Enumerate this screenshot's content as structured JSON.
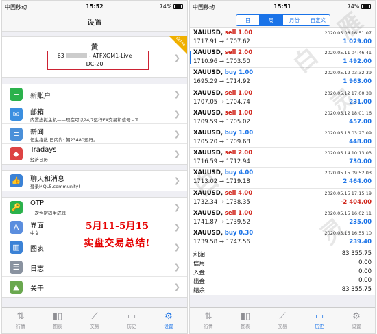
{
  "left": {
    "status": {
      "carrier": "中国移动",
      "time": "15:52",
      "battery": "74%"
    },
    "title": "设置",
    "account": {
      "name": "黄",
      "number": "63",
      "server_suffix": "- ATFXGM1-Live",
      "server_line2": "DC-20",
      "badge": "demo"
    },
    "group1": [
      {
        "icon": "user-plus-icon",
        "color": "#2bb24c",
        "glyph": "+",
        "title": "新账户",
        "sub": ""
      },
      {
        "icon": "mail-icon",
        "color": "#3b8fe0",
        "glyph": "✉",
        "title": "邮箱",
        "sub": "内置虚拟主机——现在可以24/7运行EA交易和信号 - Tr..."
      },
      {
        "icon": "news-icon",
        "color": "#4a90d9",
        "glyph": "≡",
        "title": "新闻",
        "sub": "恒生指数 日内尚: 朝23480运行。"
      },
      {
        "icon": "tradays-icon",
        "color": "#d44",
        "glyph": "◆",
        "title": "Tradays",
        "sub": "经济日历"
      }
    ],
    "group2": [
      {
        "icon": "chat-icon",
        "color": "#3b82d6",
        "glyph": "👍",
        "title": "聊天和消息",
        "sub": "登录MQL5.community!"
      }
    ],
    "group3": [
      {
        "icon": "otp-icon",
        "color": "#2bb24c",
        "glyph": "🔑",
        "title": "OTP",
        "sub": "一次性密码生成器"
      },
      {
        "icon": "language-icon",
        "color": "#5b8ede",
        "glyph": "A",
        "title": "界面",
        "sub": "中文"
      },
      {
        "icon": "chart-settings-icon",
        "color": "#3b82d6",
        "glyph": "▥",
        "title": "图表",
        "sub": ""
      },
      {
        "icon": "journal-icon",
        "color": "#8a93a0",
        "glyph": "☰",
        "title": "日志",
        "sub": ""
      },
      {
        "icon": "about-icon",
        "color": "#6aa84f",
        "glyph": "▲",
        "title": "关于",
        "sub": ""
      }
    ],
    "overlay": {
      "line1": "5月11-5月15",
      "line2": "实盘交易总结!"
    },
    "tabs": [
      {
        "icon": "quotes-icon",
        "glyph": "⇅",
        "label": "行情"
      },
      {
        "icon": "chart-icon",
        "glyph": "▮▯",
        "label": "图表"
      },
      {
        "icon": "trade-icon",
        "glyph": "⟋",
        "label": "交易"
      },
      {
        "icon": "history-icon",
        "glyph": "▭",
        "label": "历史"
      },
      {
        "icon": "settings-icon",
        "glyph": "⚙",
        "label": "设置",
        "active": true
      }
    ]
  },
  "right": {
    "status": {
      "carrier": "中国移动",
      "time": "15:51",
      "battery": "74%"
    },
    "segments": [
      {
        "label": "日"
      },
      {
        "label": "周",
        "active": true
      },
      {
        "label": "月份"
      },
      {
        "label": "自定义"
      }
    ],
    "deals": [
      {
        "symbol": "XAUUSD,",
        "side": "sell",
        "lots": "1.00",
        "date": "2020.05.08 16:51:07",
        "prices": "1717.91 → 1707.62",
        "profit": "1 029.00",
        "sign": "pos"
      },
      {
        "symbol": "XAUUSD,",
        "side": "sell",
        "lots": "2.00",
        "date": "2020.05.11 04:46:41",
        "prices": "1710.96 → 1703.50",
        "profit": "1 492.00",
        "sign": "pos"
      },
      {
        "symbol": "XAUUSD,",
        "side": "buy",
        "lots": "1.00",
        "date": "2020.05.12 03:32:39",
        "prices": "1695.29 → 1714.92",
        "profit": "1 963.00",
        "sign": "pos"
      },
      {
        "symbol": "XAUUSD,",
        "side": "sell",
        "lots": "1.00",
        "date": "2020.05.12 17:00:38",
        "prices": "1707.05 → 1704.74",
        "profit": "231.00",
        "sign": "pos"
      },
      {
        "symbol": "XAUUSD,",
        "side": "sell",
        "lots": "1.00",
        "date": "2020.05.12 18:01:16",
        "prices": "1709.59 → 1705.02",
        "profit": "457.00",
        "sign": "pos"
      },
      {
        "symbol": "XAUUSD,",
        "side": "buy",
        "lots": "1.00",
        "date": "2020.05.13 03:27:09",
        "prices": "1705.20 → 1709.68",
        "profit": "448.00",
        "sign": "pos"
      },
      {
        "symbol": "XAUUSD,",
        "side": "sell",
        "lots": "2.00",
        "date": "2020.05.14 10:13:03",
        "prices": "1716.59 → 1712.94",
        "profit": "730.00",
        "sign": "pos"
      },
      {
        "symbol": "XAUUSD,",
        "side": "buy",
        "lots": "4.00",
        "date": "2020.05.15 09:52:03",
        "prices": "1713.02 → 1719.18",
        "profit": "2 464.00",
        "sign": "pos"
      },
      {
        "symbol": "XAUUSD,",
        "side": "sell",
        "lots": "4.00",
        "date": "2020.05.15 17:15:19",
        "prices": "1732.34 → 1738.35",
        "profit": "-2 404.00",
        "sign": "neg"
      },
      {
        "symbol": "XAUUSD,",
        "side": "sell",
        "lots": "1.00",
        "date": "2020.05.15 16:02:11",
        "prices": "1741.87 → 1739.52",
        "profit": "235.00",
        "sign": "pos"
      },
      {
        "symbol": "XAUUSD,",
        "side": "buy",
        "lots": "0.30",
        "date": "2020.05.15 16:55:10",
        "prices": "1739.58 → 1747.56",
        "profit": "239.40",
        "sign": "pos"
      }
    ],
    "summary": [
      {
        "label": "利润:",
        "value": "83 355.75"
      },
      {
        "label": "信用:",
        "value": "0.00"
      },
      {
        "label": "入金:",
        "value": "0.00"
      },
      {
        "label": "出金:",
        "value": "0.00"
      },
      {
        "label": "结余:",
        "value": "83 355.75"
      }
    ],
    "watermark": [
      "白",
      "灵",
      "白",
      "灵",
      "雁"
    ],
    "tabs": [
      {
        "icon": "quotes-icon",
        "glyph": "⇅",
        "label": "行情"
      },
      {
        "icon": "chart-icon",
        "glyph": "▮▯",
        "label": "图表"
      },
      {
        "icon": "trade-icon",
        "glyph": "⟋",
        "label": "交易"
      },
      {
        "icon": "history-icon",
        "glyph": "▭",
        "label": "历史",
        "active": true
      },
      {
        "icon": "settings-icon",
        "glyph": "⚙",
        "label": "设置"
      }
    ]
  }
}
